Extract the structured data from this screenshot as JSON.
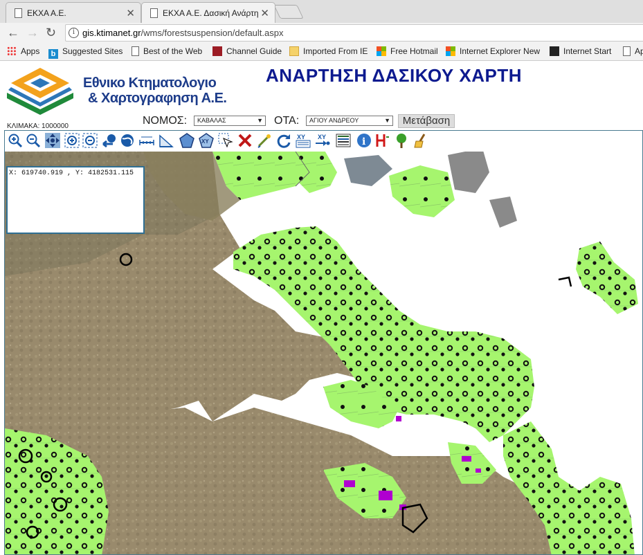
{
  "browser": {
    "tabs": [
      {
        "title": "ΕΚΧΑ Α.Ε.",
        "active": false
      },
      {
        "title": "ΕΚΧΑ Α.Ε. Δασική Ανάρτη",
        "active": true
      }
    ],
    "url_host": "gis.ktimanet.gr",
    "url_path": "/wms/forestsuspension/default.aspx",
    "bookmarks": [
      {
        "label": "Apps",
        "icon": "apps-icon"
      },
      {
        "label": "Suggested Sites",
        "icon": "bing-icon"
      },
      {
        "label": "Best of the Web",
        "icon": "page-icon"
      },
      {
        "label": "Channel Guide",
        "icon": "channel-icon"
      },
      {
        "label": "Imported From IE",
        "icon": "folder-icon"
      },
      {
        "label": "Free Hotmail",
        "icon": "windows-icon"
      },
      {
        "label": "Internet Explorer News",
        "icon": "windows-icon"
      },
      {
        "label": "Internet Start",
        "icon": "k-icon"
      },
      {
        "label": "Ap",
        "icon": "page-icon"
      }
    ]
  },
  "header": {
    "logo_line1": "Εθνικο Κτηματολογιο",
    "logo_line2": "& Χαρτογραφηση Α.Ε.",
    "title": "ΑΝΑΡΤΗΣΗ ΔΑΣΙΚΟΥ ΧΑΡΤΗ",
    "scale_label": "ΚΛΙΜΑΚΑ: 1000000"
  },
  "filters": {
    "nomos_label": "ΝΟΜΟΣ:",
    "nomos_value": "ΚΑΒΑΛΑΣ",
    "ota_label": "ΟΤΑ:",
    "ota_value": "ΑΓΙΟΥ ΑΝΔΡΕΟΥ",
    "go_label": "Μετάβαση"
  },
  "map": {
    "coordinates": "X: 619740.919 , Y: 4182531.115",
    "tools": [
      "zoom-in-icon",
      "zoom-out-icon",
      "pan-icon",
      "zoom-box-in-icon",
      "zoom-box-out-icon",
      "previous-view-icon",
      "full-extent-icon",
      "measure-distance-icon",
      "measure-area-icon",
      "polygon-icon",
      "xy-polygon-icon",
      "select-icon",
      "clear-icon",
      "draw-point-icon",
      "refresh-icon",
      "xy-list-icon",
      "xy-goto-icon",
      "legend-icon",
      "info-icon",
      "history-icon",
      "forest-icon",
      "clear-brush-icon"
    ],
    "colors": {
      "forest": "#a6f56e",
      "sea": "#ffffff",
      "land": "#9a8a6c",
      "highlight": "#b000d0",
      "boundary": "#000000"
    }
  }
}
